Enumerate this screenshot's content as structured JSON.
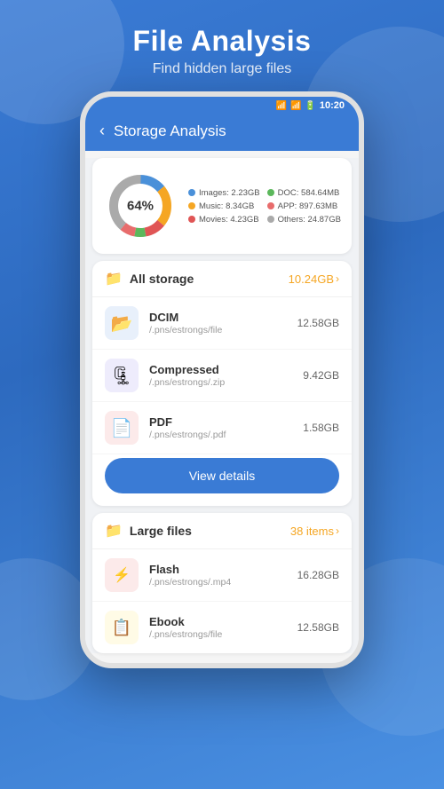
{
  "header": {
    "title": "File Analysis",
    "subtitle": "Find hidden large files"
  },
  "status_bar": {
    "time": "10:20"
  },
  "top_bar": {
    "title": "Storage Analysis",
    "back_label": "<"
  },
  "chart": {
    "percentage": "64%",
    "legend": [
      {
        "label": "Images: 2.23GB",
        "color": "#4a90d9"
      },
      {
        "label": "DOC: 584.64MB",
        "color": "#5cb85c"
      },
      {
        "label": "Music: 8.34GB",
        "color": "#f5a623"
      },
      {
        "label": "APP: 897.63MB",
        "color": "#e86c6c"
      },
      {
        "label": "Movies: 4.23GB",
        "color": "#e05555"
      },
      {
        "label": "Others: 24.87GB",
        "color": "#aaaaaa"
      }
    ],
    "donut_segments": [
      {
        "label": "Images",
        "color": "#4a90d9",
        "percent": 14
      },
      {
        "label": "Music",
        "color": "#f5a623",
        "percent": 22
      },
      {
        "label": "Movies",
        "color": "#e05555",
        "percent": 11
      },
      {
        "label": "DOC",
        "color": "#5cb85c",
        "percent": 6
      },
      {
        "label": "APP",
        "color": "#e86c6c",
        "percent": 8
      },
      {
        "label": "Others",
        "color": "#aaaaaa",
        "percent": 39
      }
    ]
  },
  "all_storage": {
    "section_icon": "📁",
    "section_title": "All storage",
    "section_meta": "10.24GB",
    "files": [
      {
        "name": "DCIM",
        "path": "/.pns/estrongs/file",
        "size": "12.58GB",
        "icon_color": "#3a7bd5",
        "icon": "📂"
      },
      {
        "name": "Compressed",
        "path": "/.pns/estrongs/.zip",
        "size": "9.42GB",
        "icon_color": "#6c63e0",
        "icon": "🗜"
      },
      {
        "name": "PDF",
        "path": "/.pns/estrongs/.pdf",
        "size": "1.58GB",
        "icon_color": "#e05555",
        "icon": "📄"
      }
    ],
    "button_label": "View details"
  },
  "large_files": {
    "section_icon": "📁",
    "section_title": "Large files",
    "section_meta": "38 items",
    "files": [
      {
        "name": "Flash",
        "path": "/.pns/estrongs/.mp4",
        "size": "16.28GB",
        "icon_color": "#e05555",
        "icon": "⚡"
      },
      {
        "name": "Ebook",
        "path": "/.pns/estrongs/file",
        "size": "12.58GB",
        "icon_color": "#f5c842",
        "icon": "📋"
      }
    ]
  }
}
